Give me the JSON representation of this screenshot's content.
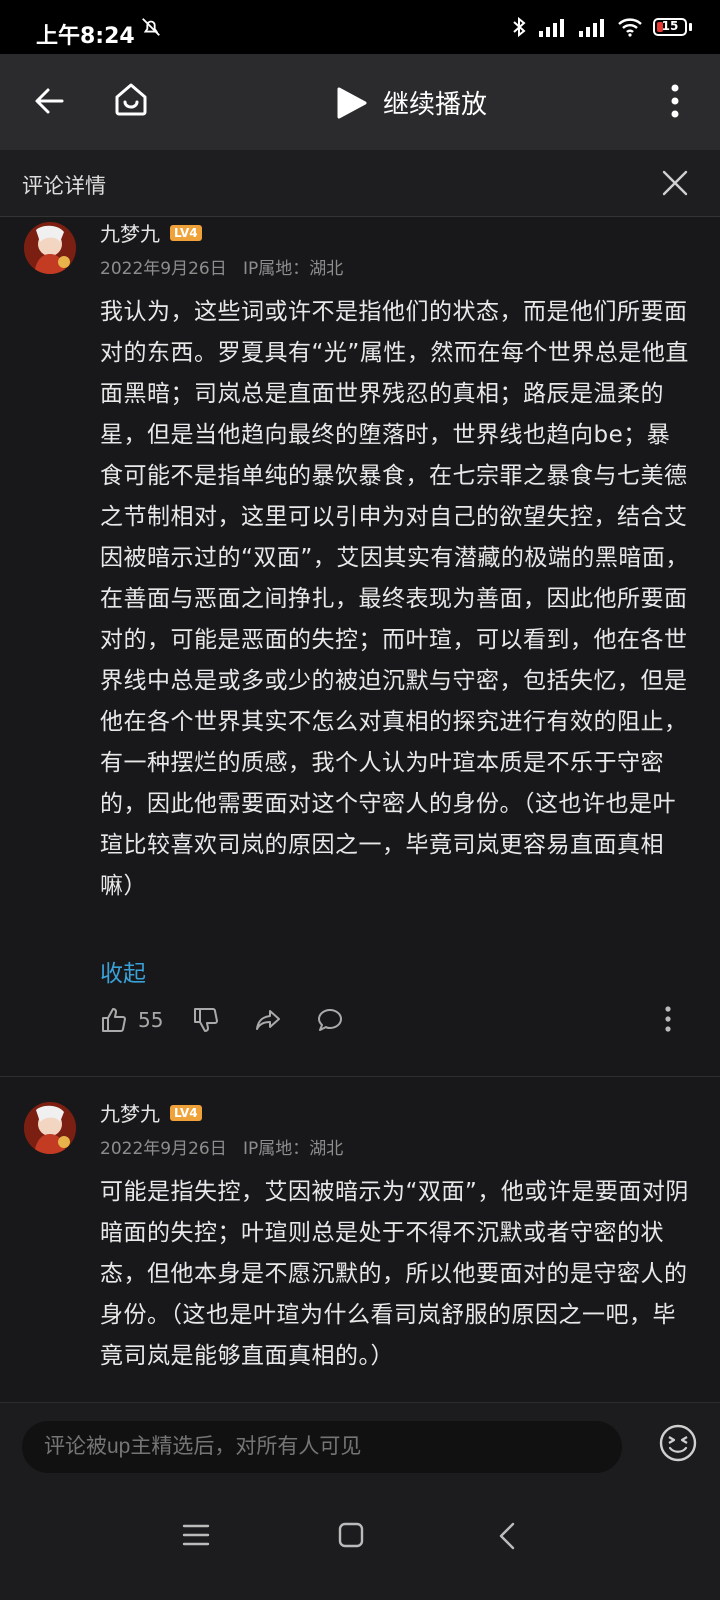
{
  "status_bar": {
    "time": "上午8:24",
    "battery": "15"
  },
  "top_bar": {
    "continue_play_label": "继续播放"
  },
  "sub_header": {
    "title": "评论详情"
  },
  "comments": [
    {
      "username": "九梦九",
      "level_badge": "LV4",
      "date": "2022年9月26日",
      "ip": "IP属地：湖北",
      "text": "我认为，这些词或许不是指他们的状态，而是他们所要面对的东西。罗夏具有“光”属性，然而在每个世界总是他直面黑暗；司岚总是直面世界残忍的真相；路辰是温柔的星，但是当他趋向最终的堕落时，世界线也趋向be；暴食可能不是指单纯的暴饮暴食，在七宗罪之暴食与七美德之节制相对，这里可以引申为对自己的欲望失控，结合艾因被暗示过的“双面”，艾因其实有潜藏的极端的黑暗面，在善面与恶面之间挣扎，最终表现为善面，因此他所要面对的，可能是恶面的失控；而叶瑄，可以看到，他在各世界线中总是或多或少的被迫沉默与守密，包括失忆，但是他在各个世界其实不怎么对真相的探究进行有效的阻止，有一种摆烂的质感，我个人认为叶瑄本质是不乐于守密的，因此他需要面对这个守密人的身份。（这也许也是叶瑄比较喜欢司岚的原因之一，毕竟司岚更容易直面真相嘛）",
      "collapse_label": "收起",
      "likes": "55"
    },
    {
      "username": "九梦九",
      "level_badge": "LV4",
      "date": "2022年9月26日",
      "ip": "IP属地：湖北",
      "text": "可能是指失控，艾因被暗示为“双面”，他或许是要面对阴暗面的失控；叶瑄则总是处于不得不沉默或者守密的状态，但他本身是不愿沉默的，所以他要面对的是守密人的身份。（这也是叶瑄为什么看司岚舒服的原因之一吧，毕竟司岚是能够直面真相的。）"
    }
  ],
  "composer": {
    "placeholder": "评论被up主精选后，对所有人可见"
  }
}
